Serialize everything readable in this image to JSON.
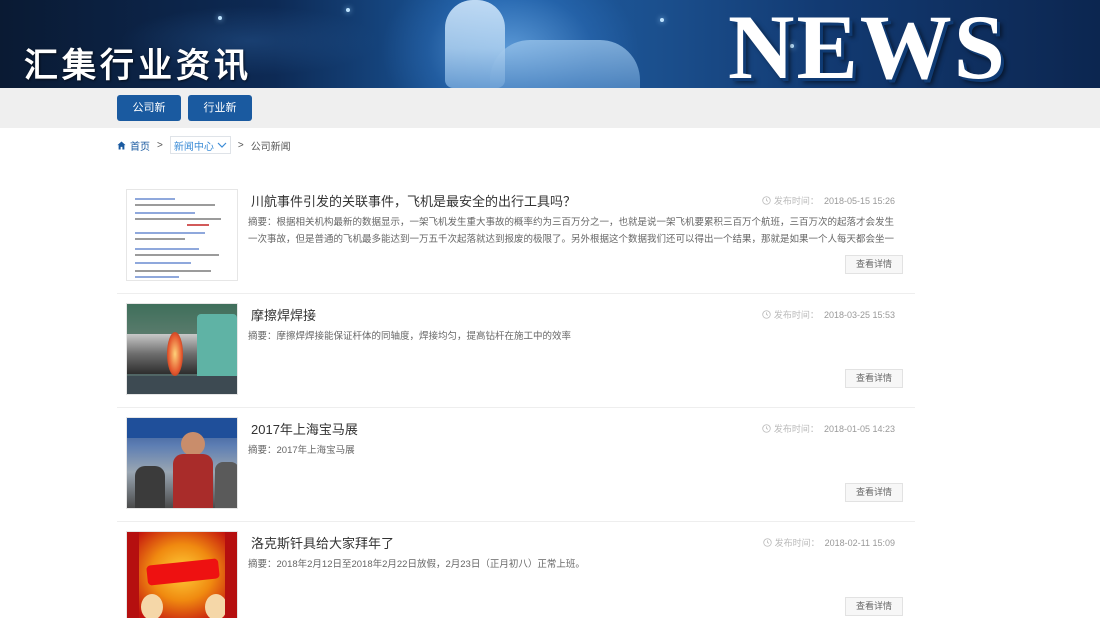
{
  "banner": {
    "title": "汇集行业资讯",
    "news_word": "NEWS"
  },
  "nav": {
    "buttons": [
      {
        "label": "公司新闻"
      },
      {
        "label": "行业新闻"
      }
    ]
  },
  "breadcrumb": {
    "home": "首页",
    "sep": ">",
    "section": "新闻中心",
    "current": "公司新闻"
  },
  "news": {
    "date_label": "发布时间：",
    "detail_label": "查看详情",
    "items": [
      {
        "title": "川航事件引发的关联事件，飞机是最安全的出行工具吗？",
        "date": "2018-05-15 15:26",
        "summary": "摘要：根据相关机构最新的数据显示，一架飞机发生重大事故的概率约为三百万分之一，也就是说一架飞机要累积三百万个航班，三百万次的起落才会发生一次事故，但是普通的飞机最多能达到一万五千次起落就达到报废的极限了。另外根据这个数据我们还可以得出一个结果，那就是如果一个人每天都会坐一次飞机...",
        "thumb_icon": "search-results-screenshot"
      },
      {
        "title": "摩擦焊焊接",
        "date": "2018-03-25 15:53",
        "summary": "摘要：摩擦焊焊接能保证杆体的同轴度，焊接均匀，提高钻杆在施工中的效率",
        "thumb_icon": "friction-welding-machine-photo"
      },
      {
        "title": "2017年上海宝马展",
        "date": "2018-01-05 14:23",
        "summary": "摘要：2017年上海宝马展",
        "thumb_icon": "exhibition-photo"
      },
      {
        "title": "洛克斯钎具给大家拜年了",
        "date": "2018-02-11 15:09",
        "summary": "摘要：2018年2月12日至2018年2月22日放假，2月23日（正月初八）正常上班。",
        "thumb_icon": "new-year-greeting-poster"
      }
    ]
  },
  "colors": {
    "brand": "#1a5aa0",
    "nav_bg": "#efefef",
    "link": "#3a8bd6"
  }
}
